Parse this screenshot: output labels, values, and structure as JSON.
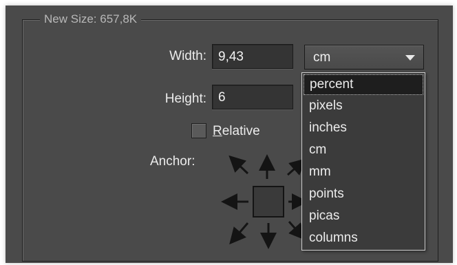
{
  "group": {
    "title": "New Size: 657,8K"
  },
  "width": {
    "label": "Width:",
    "value": "9,43"
  },
  "height": {
    "label": "Height:",
    "value": "6"
  },
  "unit": {
    "selected": "cm",
    "options": [
      "percent",
      "pixels",
      "inches",
      "cm",
      "mm",
      "points",
      "picas",
      "columns"
    ],
    "highlighted": "percent"
  },
  "relative": {
    "label_prefix": "R",
    "label_rest": "elative",
    "checked": false
  },
  "anchor": {
    "label": "Anchor:"
  },
  "colors": {
    "panel": "#4a4a4a",
    "text": "#ececec",
    "dropdown_bg": "#3b3b3b"
  }
}
